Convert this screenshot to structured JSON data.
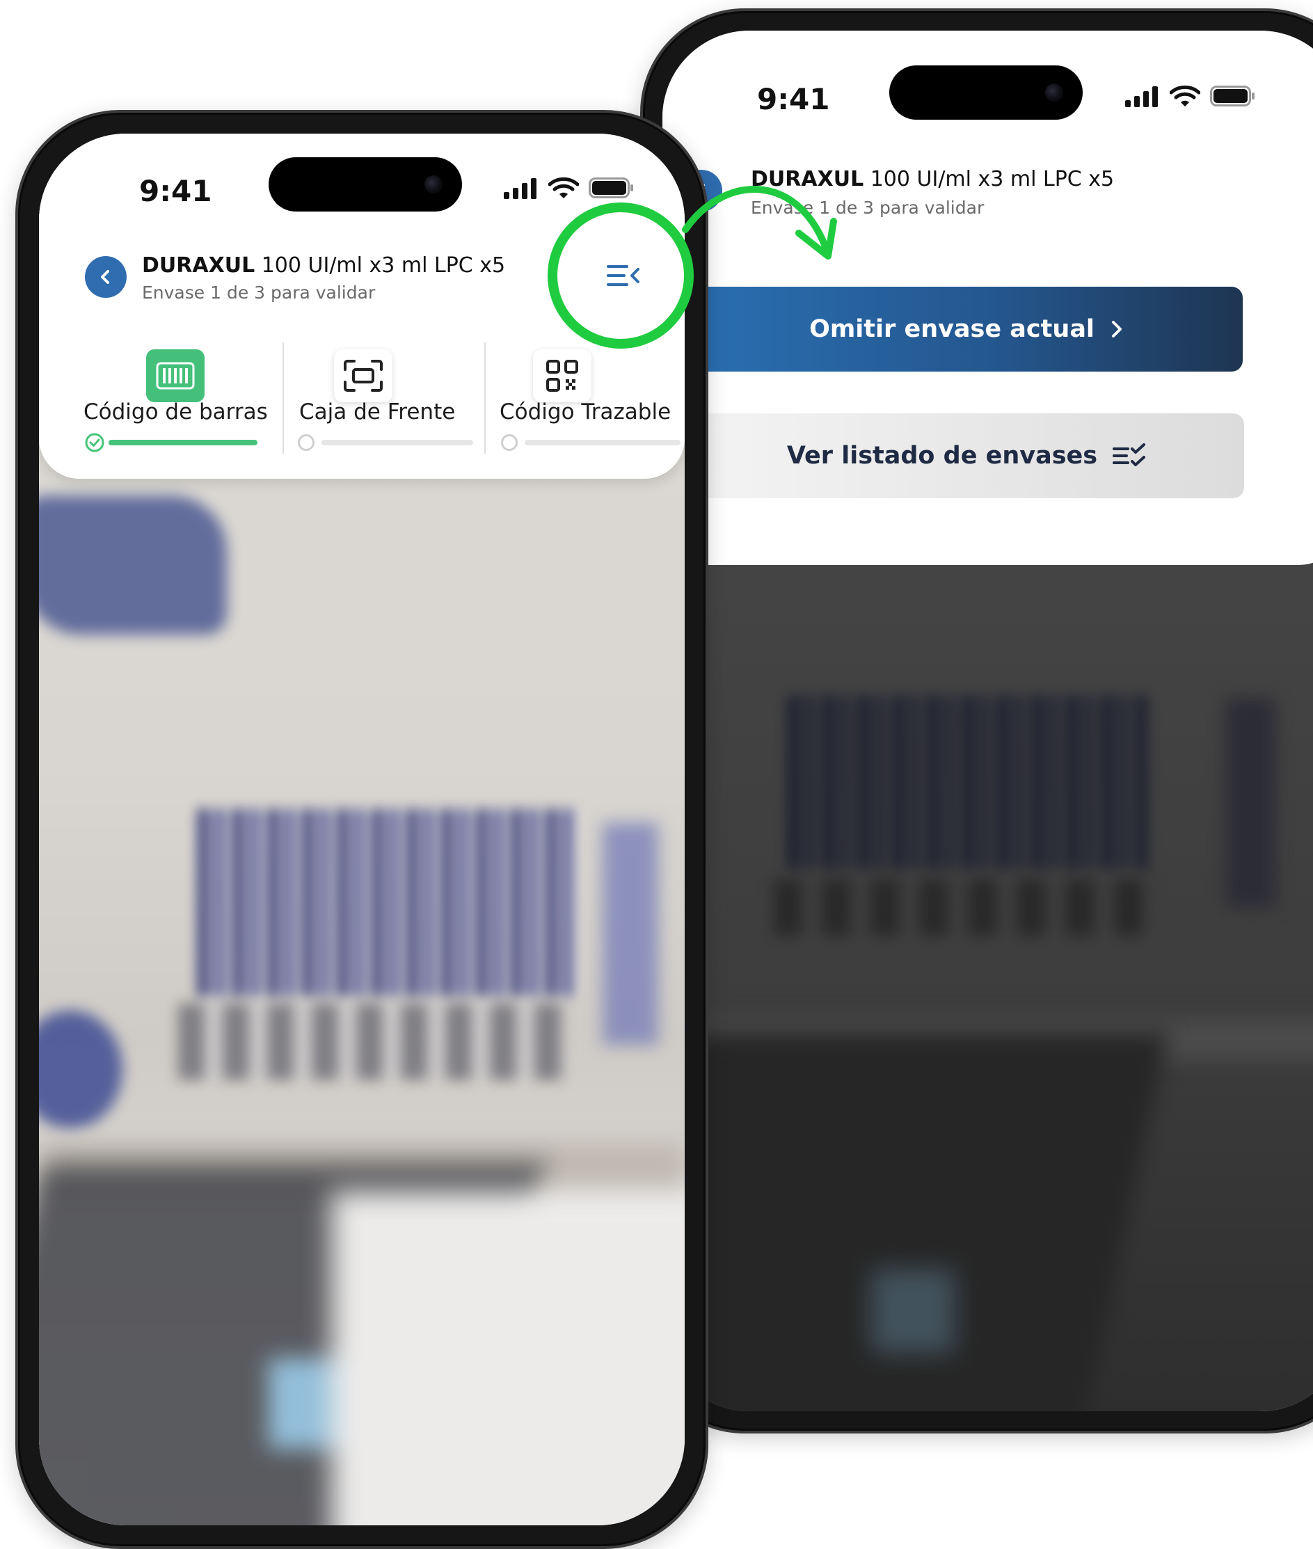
{
  "colors": {
    "brand_blue": "#2f6db0",
    "progress_green": "#46c37a",
    "highlight_green": "#1fcc3f",
    "button_dark": "#1e3552"
  },
  "phone_left": {
    "status_time": "9:41",
    "header": {
      "back_icon": "chevron-left-icon",
      "brand": "DURAXUL",
      "title_rest": " 100 UI/ml x3 ml LPC x5",
      "subtitle": "Envase 1 de 3 para validar",
      "menu_icon": "list-collapse-icon"
    },
    "tabs": [
      {
        "label": "Código de barras",
        "icon": "barcode-icon",
        "state": "completed",
        "progress": 1.0
      },
      {
        "label": "Caja de Frente",
        "icon": "scan-frame-icon",
        "state": "pending",
        "progress": 0.0
      },
      {
        "label": "Código Trazable",
        "icon": "qr-code-icon",
        "state": "pending",
        "progress": 0.0
      }
    ]
  },
  "phone_right": {
    "status_time": "9:41",
    "header": {
      "back_icon": "chevron-left-icon",
      "brand": "DURAXUL",
      "title_rest": " 100 UI/ml x3 ml LPC x5",
      "subtitle": "Envase 1 de 3 para validar"
    },
    "menu": {
      "skip_label": "Omitir envase actual",
      "skip_icon": "chevron-right-icon",
      "list_label": "Ver listado de envases",
      "list_icon": "list-check-icon"
    }
  }
}
